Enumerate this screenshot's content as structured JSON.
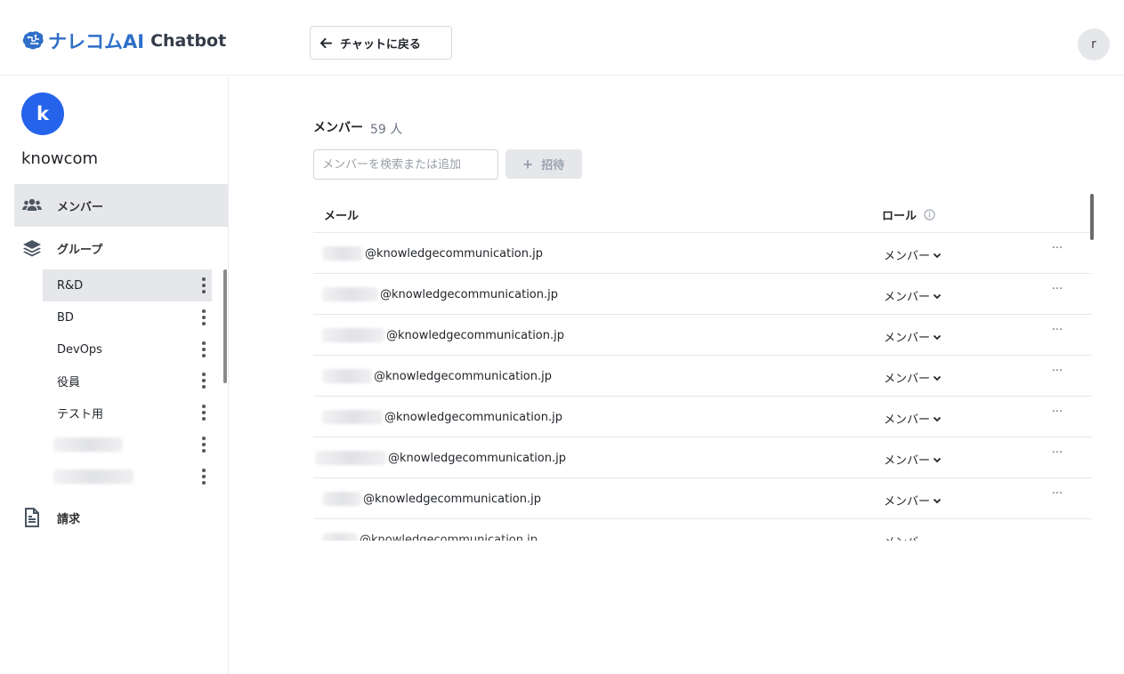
{
  "header": {
    "logo_jp": "ナレコムAI",
    "logo_en": "Chatbot",
    "back_label": "チャットに戻る",
    "user_initial": "r"
  },
  "sidebar": {
    "org_initial": "k",
    "org_name": "knowcom",
    "nav": [
      {
        "label": "メンバー",
        "icon": "users-icon",
        "active": true
      },
      {
        "label": "グループ",
        "icon": "layers-icon",
        "active": false
      },
      {
        "label": "請求",
        "icon": "document-icon",
        "active": false
      }
    ],
    "groups": [
      {
        "label": "R&D",
        "active": true
      },
      {
        "label": "BD"
      },
      {
        "label": "DevOps"
      },
      {
        "label": "役員"
      },
      {
        "label": "テスト用"
      },
      {
        "label": ""
      },
      {
        "label": ""
      }
    ]
  },
  "main": {
    "title": "メンバー",
    "count": "59 人",
    "search_placeholder": "メンバーを検索または追加",
    "invite_label": "招待",
    "columns": {
      "mail": "メール",
      "role": "ロール"
    },
    "rows": [
      {
        "domain": "@knowledgecommunication.jp",
        "role": "メンバー"
      },
      {
        "domain": "@knowledgecommunication.jp",
        "role": "メンバー"
      },
      {
        "domain": "@knowledgecommunication.jp",
        "role": "メンバー"
      },
      {
        "domain": "@knowledgecommunication.jp",
        "role": "メンバー"
      },
      {
        "domain": "@knowledgecommunication.jp",
        "role": "メンバー"
      },
      {
        "domain": "@knowledgecommunication.jp",
        "role": "メンバー"
      },
      {
        "domain": "@knowledgecommunication.jp",
        "role": "メンバー"
      },
      {
        "domain": "@knowledgecommunication.jp",
        "role": "メンバー"
      }
    ],
    "more_glyph": "···"
  },
  "colors": {
    "brand_blue": "#2f6fc8",
    "org_avatar": "#2563eb",
    "active_bg": "#e6e7ea"
  }
}
